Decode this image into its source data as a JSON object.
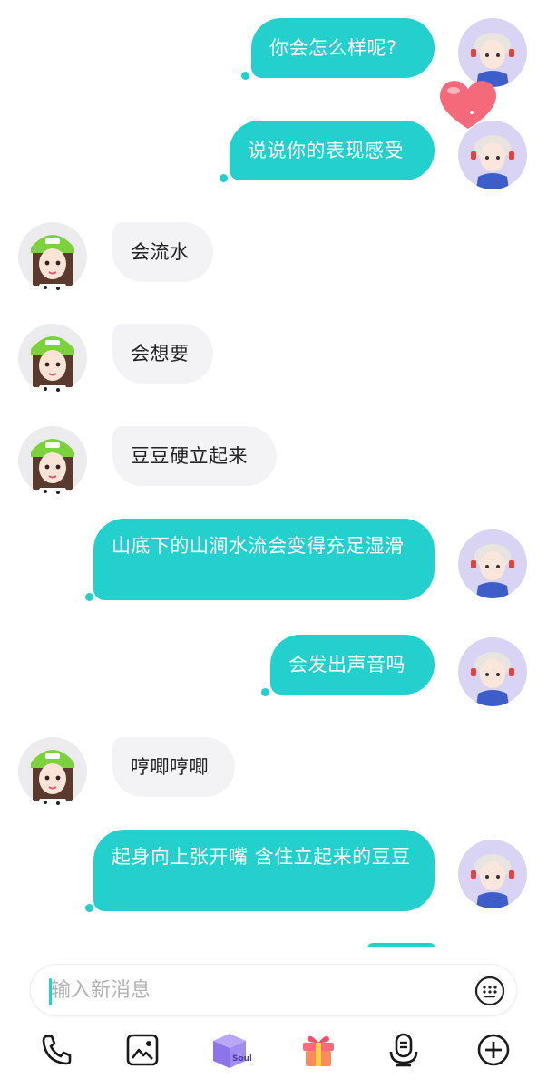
{
  "messages": [
    {
      "from": "me",
      "text": "你会怎么样呢?"
    },
    {
      "from": "me",
      "text": "说说你的表现感受"
    },
    {
      "from": "them",
      "text": "会流水"
    },
    {
      "from": "them",
      "text": "会想要"
    },
    {
      "from": "them",
      "text": "豆豆硬立起来"
    },
    {
      "from": "me",
      "text": "山底下的山涧水流会变得充足湿滑"
    },
    {
      "from": "me",
      "text": "会发出声音吗"
    },
    {
      "from": "them",
      "text": "哼唧哼唧"
    },
    {
      "from": "me",
      "text": "起身向上张开嘴 含住立起来的豆豆"
    }
  ],
  "input": {
    "placeholder": "输入新消息"
  },
  "toolbar": {
    "items": [
      "phone-icon",
      "image-icon",
      "soul-box-icon",
      "gift-icon",
      "voice-icon",
      "add-icon"
    ],
    "soul_label": "Soul"
  },
  "colors": {
    "accent": "#23d0cd",
    "incoming_bubble": "#f3f3f5",
    "heart": "#f46a7a"
  }
}
